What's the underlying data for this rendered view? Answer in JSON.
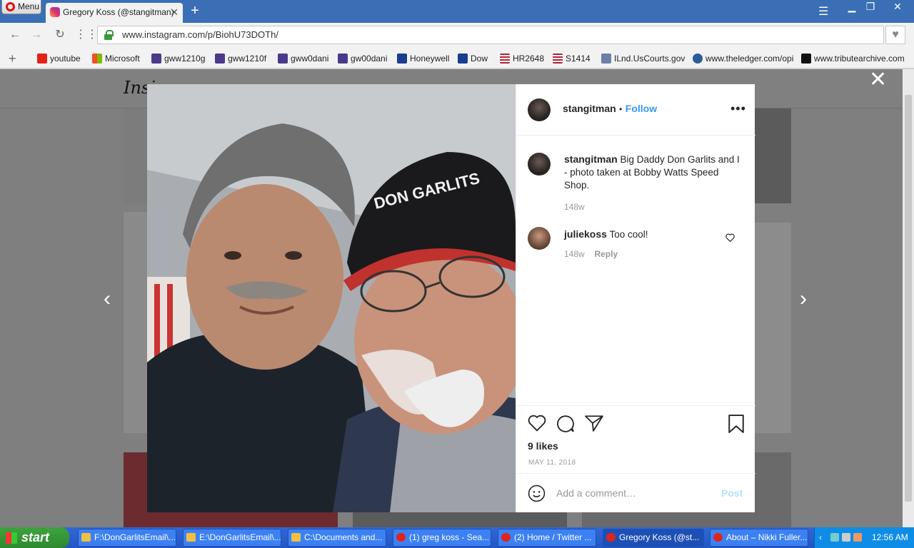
{
  "browser": {
    "menu_label": "Menu",
    "tab_title": "Gregory Koss (@stangitman)",
    "tab_close": "✕",
    "new_tab": "+",
    "url": "www.instagram.com/p/BiohU73DOTh/",
    "bookmarks": [
      {
        "label": "youtube",
        "color": "#e62117"
      },
      {
        "label": "Microsoft",
        "color": "#f25022"
      },
      {
        "label": "gww1210g",
        "color": "#4b3a8c"
      },
      {
        "label": "gww1210f",
        "color": "#4b3a8c"
      },
      {
        "label": "gww0dani",
        "color": "#4b3a8c"
      },
      {
        "label": "gw00dani",
        "color": "#4b3a8c"
      },
      {
        "label": "Honeywell",
        "color": "#1a3d8f"
      },
      {
        "label": "Dow",
        "color": "#1a3d8f"
      },
      {
        "label": "HR2648",
        "color": "#b22234"
      },
      {
        "label": "S1414",
        "color": "#b22234"
      },
      {
        "label": "ILnd.UsCourts.gov",
        "color": "#6d7fa8"
      },
      {
        "label": "www.theledger.com/opi",
        "color": "#2a5d9b"
      },
      {
        "label": "www.tributearchive.com",
        "color": "#111111"
      }
    ]
  },
  "page": {
    "logo": "Insi"
  },
  "post": {
    "username": "stangitman",
    "follow_label": "Follow",
    "separator": "•",
    "more_icon": "•••",
    "caption": "Big Daddy Don Garlits and I - photo taken at Bobby Watts Speed Shop.",
    "caption_age": "148w",
    "comments": [
      {
        "username": "juliekoss",
        "text": "Too cool!",
        "age": "148w",
        "reply_label": "Reply"
      }
    ],
    "likes": "9 likes",
    "date": "MAY 11, 2018",
    "comment_placeholder": "Add a comment…",
    "post_label": "Post"
  },
  "taskbar": {
    "start_label": "start",
    "tasks": [
      {
        "label": "F:\\DonGarlitsEmail\\...",
        "icon_color": "#f0c040"
      },
      {
        "label": "E:\\DonGarlitsEmail\\...",
        "icon_color": "#f0c040"
      },
      {
        "label": "C:\\Documents and...",
        "icon_color": "#f0c040"
      },
      {
        "label": "(1) greg koss - Sea...",
        "icon_color": "#e2231a"
      },
      {
        "label": "(2) Home / Twitter ...",
        "icon_color": "#e2231a"
      },
      {
        "label": "Gregory Koss (@st...",
        "icon_color": "#e2231a"
      },
      {
        "label": "About – Nikki Fuller...",
        "icon_color": "#e2231a"
      }
    ],
    "clock": "12:56 AM"
  }
}
